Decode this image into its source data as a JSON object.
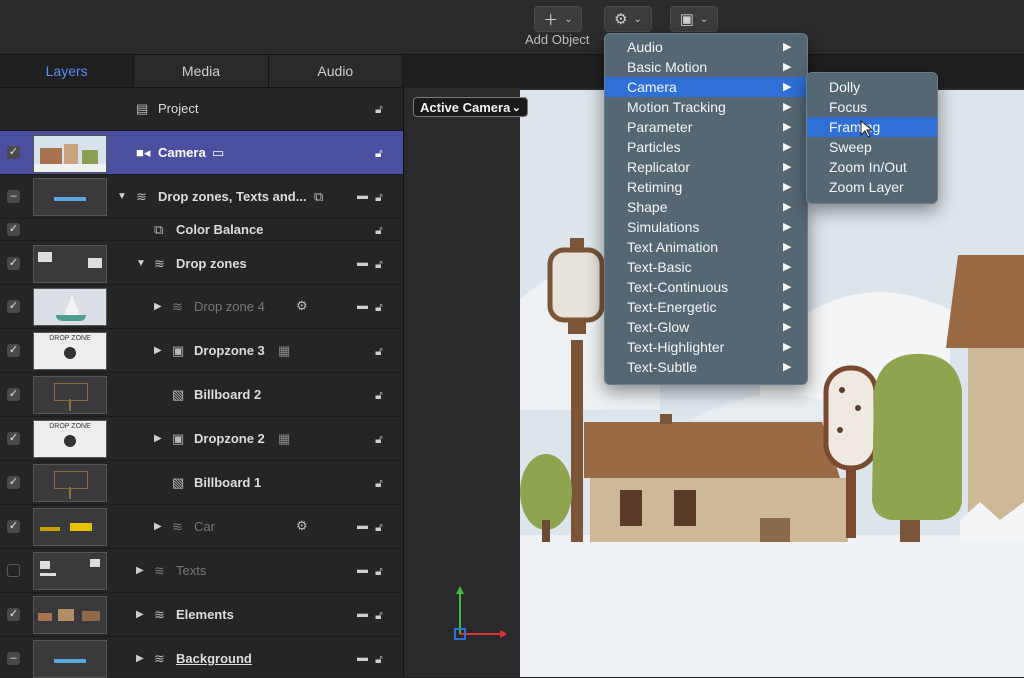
{
  "toolbar": {
    "add_object_label": "Add Object",
    "add_icon": "plus-icon",
    "behaviors_icon": "gear-icon",
    "layout_icon": "window-icon"
  },
  "tabs": [
    "Layers",
    "Media",
    "Audio"
  ],
  "layers": {
    "project": "Project",
    "camera": "Camera",
    "drop_zones_texts": "Drop zones, Texts and...",
    "color_balance": "Color Balance",
    "drop_zones": "Drop zones",
    "drop_zone_4": "Drop zone 4",
    "dropzone_3": "Dropzone 3",
    "billboard_2": "Billboard 2",
    "dropzone_2": "Dropzone 2",
    "billboard_1": "Billboard 1",
    "car": "Car",
    "texts": "Texts",
    "elements": "Elements",
    "background": "Background",
    "drop_zone_thumb_text": "DROP ZONE"
  },
  "canvas": {
    "active_camera": "Active Camera"
  },
  "menu": {
    "items": [
      "Audio",
      "Basic Motion",
      "Camera",
      "Motion Tracking",
      "Parameter",
      "Particles",
      "Replicator",
      "Retiming",
      "Shape",
      "Simulations",
      "Text Animation",
      "Text-Basic",
      "Text-Continuous",
      "Text-Energetic",
      "Text-Glow",
      "Text-Highlighter",
      "Text-Subtle"
    ],
    "highlighted": "Camera"
  },
  "submenu": {
    "items": [
      "Dolly",
      "Focus",
      "Framing",
      "Sweep",
      "Zoom In/Out",
      "Zoom Layer"
    ],
    "highlighted": "Framing"
  },
  "colors": {
    "selection": "#4a4fa0",
    "menu_highlight": "#2f6fd6",
    "active_tab": "#5a8df0"
  }
}
